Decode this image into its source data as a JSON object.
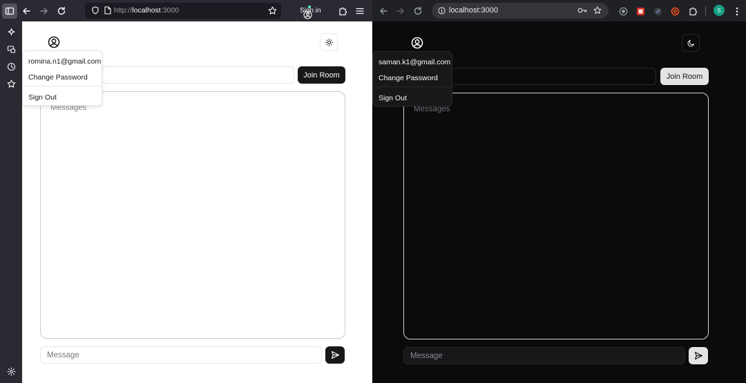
{
  "left_window": {
    "browser": {
      "url_scheme": "http://",
      "url_host": "localhost",
      "url_port": ":3000",
      "sign_in_label": "Sign in"
    },
    "app": {
      "room_placeholder": "",
      "join_room_label": "Join Room",
      "messages_placeholder": "Messages",
      "message_placeholder": "Message",
      "theme_icon": "sun-icon",
      "dropdown": {
        "email": "romina.n1@gmail.com",
        "change_password": "Change Password",
        "sign_out": "Sign Out"
      }
    }
  },
  "right_window": {
    "browser": {
      "url": "localhost:3000",
      "profile_initial": "S"
    },
    "app": {
      "room_placeholder": "",
      "join_room_label": "Join Room",
      "messages_placeholder": "Messages",
      "message_placeholder": "Message",
      "theme_icon": "moon-icon",
      "dropdown": {
        "email": "saman.k1@gmail.com",
        "change_password": "Change Password",
        "sign_out": "Sign Out"
      }
    }
  },
  "colors": {
    "light_primary": "#18181b",
    "dark_primary": "#e4e4e7",
    "dark_background": "#0b0b0b"
  }
}
